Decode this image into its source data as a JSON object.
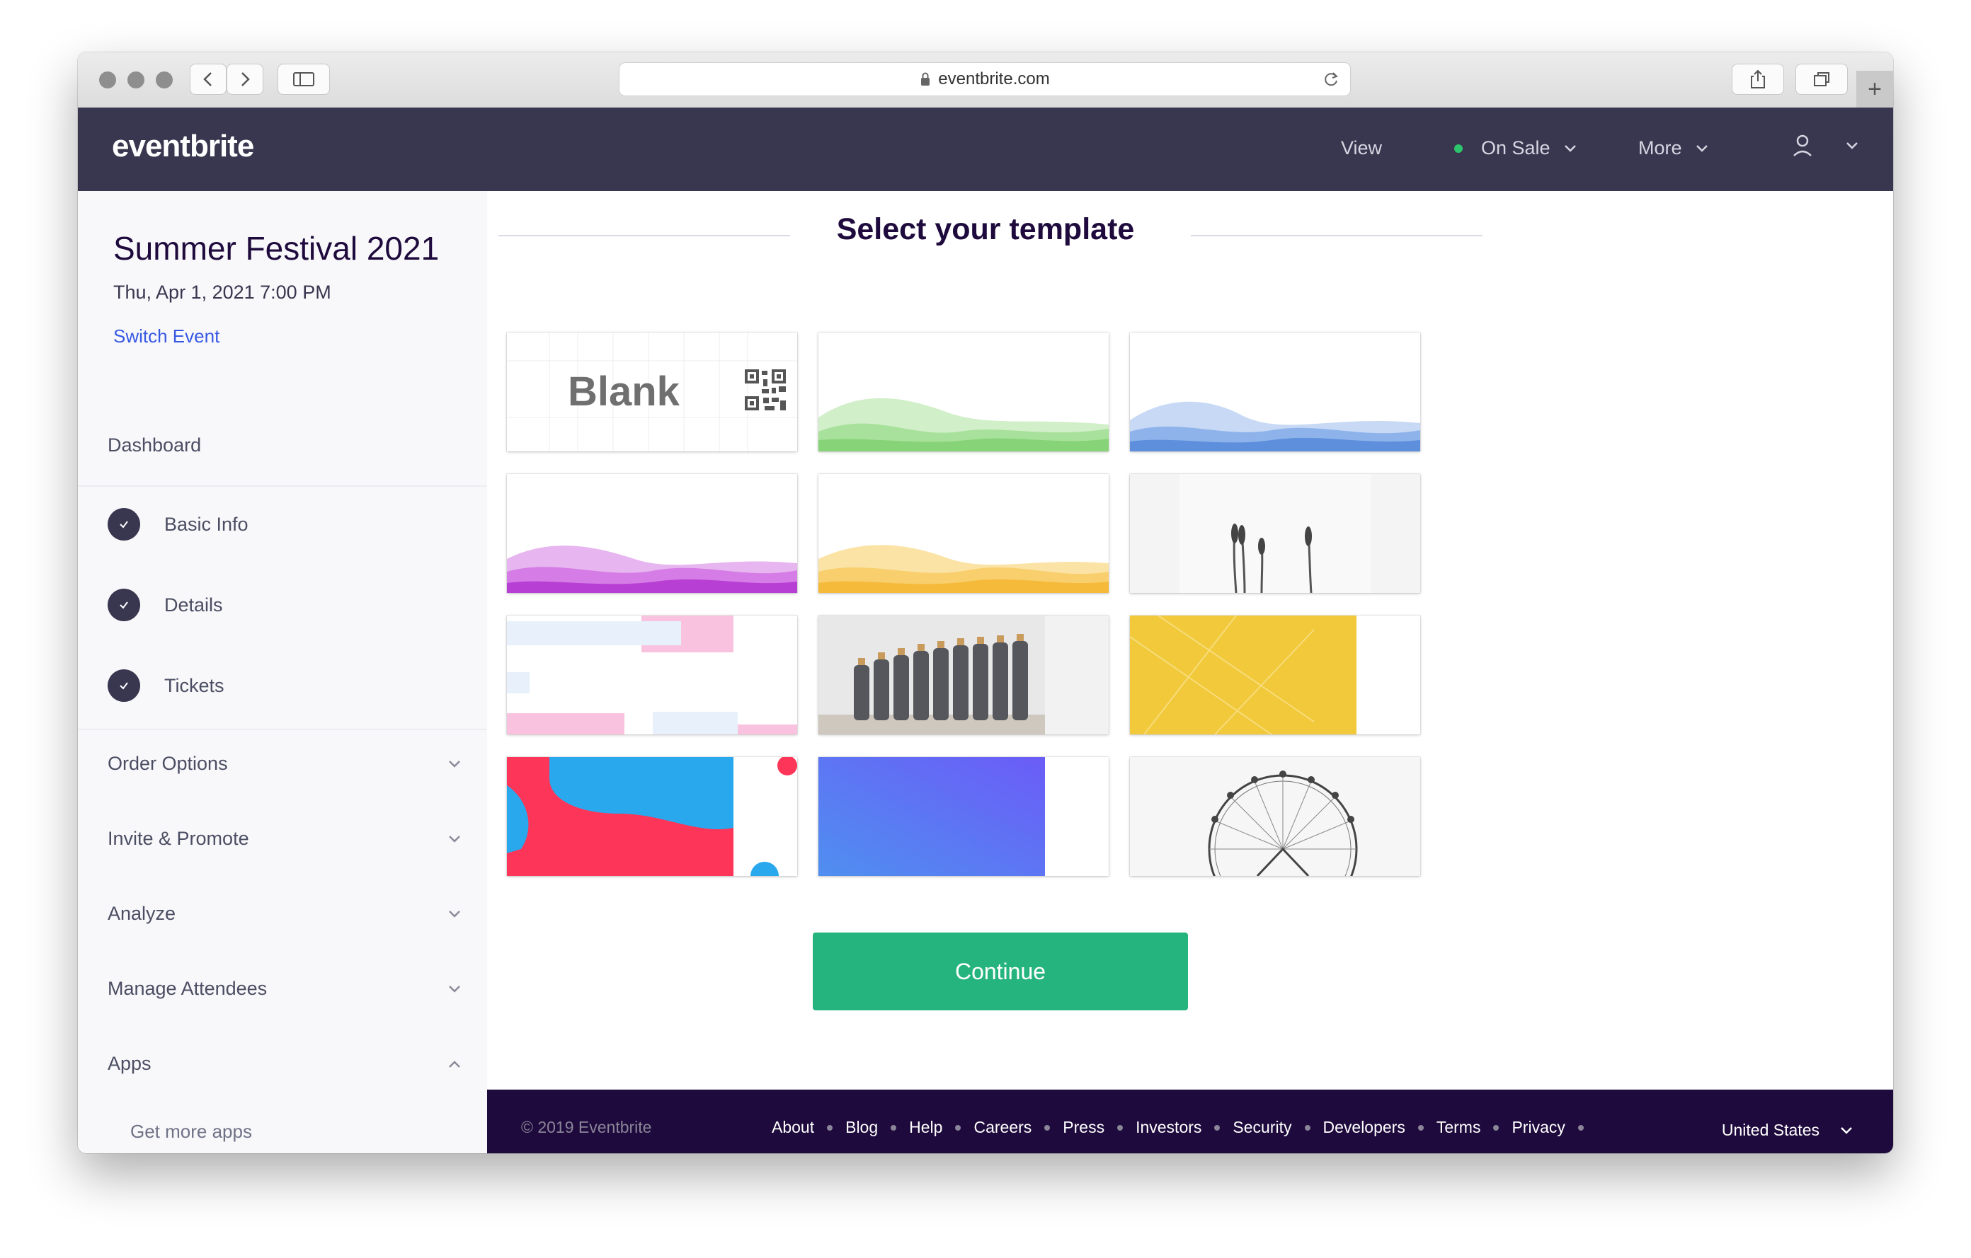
{
  "browser": {
    "url": "eventbrite.com"
  },
  "header": {
    "logo": "eventbrite",
    "view_label": "View",
    "status_label": "On Sale",
    "more_label": "More"
  },
  "sidebar": {
    "event_title": "Summer Festival 2021",
    "event_date": "Thu, Apr 1, 2021 7:00 PM",
    "switch_label": "Switch Event",
    "dashboard_label": "Dashboard",
    "steps": [
      {
        "label": "Basic Info"
      },
      {
        "label": "Details"
      },
      {
        "label": "Tickets"
      }
    ],
    "sections": [
      {
        "label": "Order Options"
      },
      {
        "label": "Invite & Promote"
      },
      {
        "label": "Analyze"
      },
      {
        "label": "Manage Attendees"
      },
      {
        "label": "Apps"
      }
    ],
    "sub_link": "Get more apps"
  },
  "main": {
    "heading": "Select your template",
    "blank_label": "Blank",
    "continue_label": "Continue"
  },
  "footer": {
    "copyright": "© 2019 Eventbrite",
    "links": [
      "About",
      "Blog",
      "Help",
      "Careers",
      "Press",
      "Investors",
      "Security",
      "Developers",
      "Terms",
      "Privacy"
    ],
    "country": "United States"
  },
  "colors": {
    "header_bg": "#39364f",
    "footer_bg": "#1e0a3c",
    "link": "#3659e3",
    "continue": "#25b47e",
    "status_dot": "#2dc56b"
  }
}
